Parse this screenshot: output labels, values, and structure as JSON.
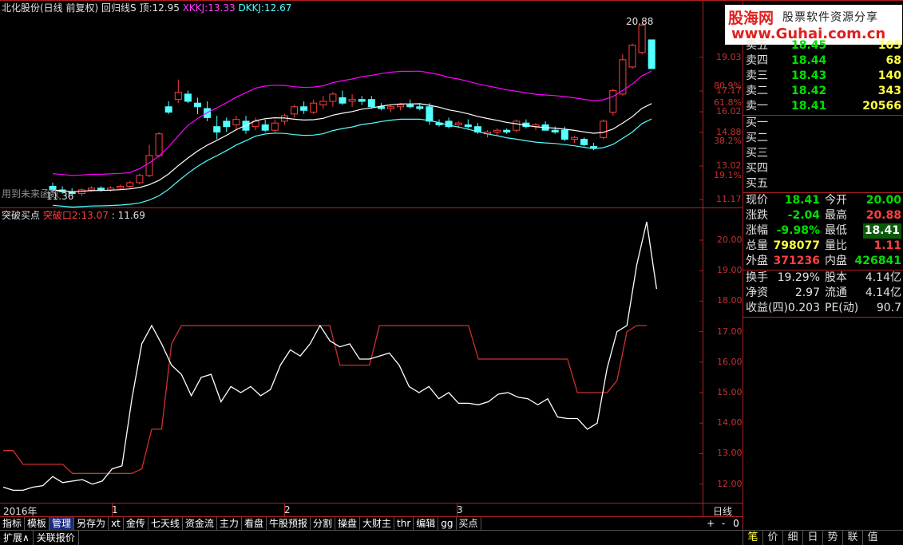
{
  "header": {
    "stock": "北化股份(日线 前复权)",
    "indicator": "回归线S",
    "top_label": "顶:",
    "top_value": "12.95",
    "xkkj_label": "XKKJ:",
    "xkkj_value": "13.33",
    "dkkj_label": "DKKJ:",
    "dkkj_value": "12.67"
  },
  "watermark": {
    "brand": "股海网",
    "slogan": "股票软件资源分享",
    "url": "www.Guhai.com.cn"
  },
  "main_chart": {
    "price_ticks": [
      "19.03",
      "17.17",
      "16.02",
      "14.88",
      "13.02",
      "11.17"
    ],
    "pct_ticks": [
      "80.9%",
      "61.8%",
      "38.2%",
      "19.1%"
    ],
    "high_label": "20.88",
    "low_label": "11.36",
    "note": "用到未来函数"
  },
  "sub_header": {
    "name": "突破买点",
    "line_label": "突破口2:",
    "line_value": "13.07",
    "extra": ": 11.69"
  },
  "sub_ticks": [
    "20.00",
    "19.00",
    "18.00",
    "17.00",
    "16.00",
    "15.00",
    "14.00",
    "13.00",
    "12.00"
  ],
  "x_axis": {
    "year": "2016年",
    "months": [
      "1",
      "2",
      "3"
    ],
    "period": "日线"
  },
  "toolbar_tabs": [
    "指标",
    "模板",
    "管理",
    "另存为",
    "xt",
    "金传",
    "七天线",
    "资金流",
    "主力",
    "看盘",
    "牛股预报",
    "分割",
    "操盘",
    "大财主",
    "thr",
    "编辑",
    "gg",
    "买点"
  ],
  "toolbar_active": "管理",
  "bottom_tabs": [
    "扩展∧",
    "关联报价"
  ],
  "zoom_buttons": [
    "+",
    "-",
    "0"
  ],
  "quote": {
    "sells": [
      {
        "label": "卖五",
        "price": "18.45",
        "vol": "105"
      },
      {
        "label": "卖四",
        "price": "18.44",
        "vol": "68"
      },
      {
        "label": "卖三",
        "price": "18.43",
        "vol": "140"
      },
      {
        "label": "卖二",
        "price": "18.42",
        "vol": "343"
      },
      {
        "label": "卖一",
        "price": "18.41",
        "vol": "20566"
      }
    ],
    "buys": [
      "买一",
      "买二",
      "买三",
      "买四",
      "买五"
    ],
    "stats": [
      {
        "l1": "现价",
        "v1": "18.41",
        "l2": "今开",
        "v2": "20.00"
      },
      {
        "l1": "涨跌",
        "v1": "-2.04",
        "l2": "最高",
        "v2": "20.88"
      },
      {
        "l1": "涨幅",
        "v1": "-9.98%",
        "l2": "最低",
        "v2": "18.41"
      },
      {
        "l1": "总量",
        "v1": "798077",
        "l2": "量比",
        "v2": "1.11"
      },
      {
        "l1": "外盘",
        "v1": "371236",
        "l2": "内盘",
        "v2": "426841"
      }
    ],
    "info": [
      {
        "l1": "换手",
        "v1": "19.29%",
        "l2": "股本",
        "v2": "4.14亿"
      },
      {
        "l1": "净资",
        "v1": "2.97",
        "l2": "流通",
        "v2": "4.14亿"
      },
      {
        "l1": "收益(四)",
        "v1": "0.203",
        "l2": "PE(动)",
        "v2": "90.7"
      }
    ]
  },
  "right_tabs": [
    "笔",
    "价",
    "细",
    "日",
    "势",
    "联",
    "值"
  ],
  "colors": {
    "up": "#ff4040",
    "down": "#54ffff",
    "upper_line": "#ff00ff",
    "mid_line": "#ffffff",
    "lower_line": "#54ffff",
    "sub_red": "#d03030",
    "frame": "#b02020",
    "green": "#00e000",
    "yellow": "#ffff40"
  },
  "chart_data": [
    {
      "type": "candlestick",
      "ylim": [
        11.17,
        20.88
      ],
      "series": [
        {
          "name": "candles",
          "ohlc": [
            [
              11.9,
              12.1,
              11.6,
              11.7
            ],
            [
              11.7,
              11.9,
              11.5,
              11.6
            ],
            [
              11.6,
              11.8,
              11.4,
              11.5
            ],
            [
              11.5,
              11.8,
              11.36,
              11.7
            ],
            [
              11.7,
              11.9,
              11.6,
              11.8
            ],
            [
              11.8,
              11.9,
              11.6,
              11.7
            ],
            [
              11.7,
              11.9,
              11.6,
              11.8
            ],
            [
              11.8,
              12.0,
              11.7,
              11.9
            ],
            [
              11.9,
              12.2,
              11.8,
              12.1
            ],
            [
              12.1,
              12.6,
              12.0,
              12.5
            ],
            [
              12.5,
              14.2,
              12.4,
              13.6
            ],
            [
              13.6,
              14.9,
              13.5,
              14.8
            ],
            [
              16.3,
              16.6,
              15.9,
              16.0
            ],
            [
              16.7,
              17.8,
              16.5,
              17.1
            ],
            [
              17.0,
              17.2,
              16.5,
              16.6
            ],
            [
              16.5,
              16.8,
              15.9,
              16.3
            ],
            [
              16.2,
              16.6,
              15.5,
              15.7
            ],
            [
              15.2,
              15.8,
              14.5,
              14.9
            ],
            [
              15.5,
              15.7,
              14.9,
              15.2
            ],
            [
              15.3,
              15.8,
              15.0,
              15.6
            ],
            [
              15.5,
              15.8,
              14.8,
              15.0
            ],
            [
              15.2,
              15.7,
              15.0,
              15.5
            ],
            [
              15.3,
              15.6,
              14.9,
              15.0
            ],
            [
              15.0,
              15.6,
              14.9,
              15.4
            ],
            [
              15.5,
              15.9,
              15.3,
              15.8
            ],
            [
              15.9,
              16.4,
              15.7,
              16.3
            ],
            [
              16.3,
              16.6,
              15.9,
              16.1
            ],
            [
              16.0,
              16.7,
              15.9,
              16.5
            ],
            [
              16.4,
              16.9,
              16.2,
              16.6
            ],
            [
              16.6,
              17.1,
              16.3,
              17.0
            ],
            [
              16.8,
              17.2,
              16.4,
              16.5
            ],
            [
              16.6,
              17.0,
              16.3,
              16.7
            ],
            [
              16.7,
              16.9,
              16.4,
              16.6
            ],
            [
              16.7,
              16.9,
              16.2,
              16.3
            ],
            [
              16.3,
              16.5,
              16.1,
              16.2
            ],
            [
              16.2,
              16.4,
              16.0,
              16.3
            ],
            [
              16.3,
              16.5,
              16.1,
              16.4
            ],
            [
              16.4,
              16.7,
              16.2,
              16.3
            ],
            [
              16.3,
              16.5,
              16.1,
              16.2
            ],
            [
              16.3,
              16.5,
              15.3,
              15.5
            ],
            [
              15.4,
              15.6,
              15.2,
              15.3
            ],
            [
              15.5,
              15.7,
              15.1,
              15.2
            ],
            [
              15.3,
              15.5,
              15.1,
              15.4
            ],
            [
              15.3,
              15.6,
              15.1,
              15.2
            ],
            [
              15.2,
              15.4,
              14.8,
              14.9
            ],
            [
              14.8,
              15.0,
              14.6,
              14.9
            ],
            [
              14.9,
              15.1,
              14.7,
              15.0
            ],
            [
              15.0,
              15.1,
              14.8,
              14.9
            ],
            [
              15.0,
              15.6,
              14.9,
              15.5
            ],
            [
              15.4,
              15.6,
              15.1,
              15.2
            ],
            [
              15.2,
              15.4,
              15.0,
              15.3
            ],
            [
              15.3,
              15.5,
              15.0,
              15.0
            ],
            [
              15.0,
              15.2,
              14.8,
              14.9
            ],
            [
              15.0,
              15.2,
              14.4,
              14.5
            ],
            [
              14.5,
              14.7,
              14.3,
              14.6
            ],
            [
              14.5,
              14.6,
              14.1,
              14.2
            ],
            [
              14.1,
              14.3,
              13.9,
              14.0
            ],
            [
              14.6,
              15.6,
              14.5,
              15.5
            ],
            [
              16.0,
              17.3,
              15.8,
              17.2
            ],
            [
              17.0,
              19.2,
              16.9,
              18.9
            ],
            [
              18.5,
              19.8,
              18.4,
              19.7
            ],
            [
              19.3,
              20.88,
              19.2,
              20.8
            ],
            [
              20.0,
              20.0,
              18.41,
              18.41
            ]
          ]
        }
      ]
    },
    {
      "type": "line",
      "ylim": [
        11.6,
        20.6
      ],
      "series": [
        {
          "name": "突破买点",
          "values": [
            11.9,
            11.8,
            11.8,
            11.9,
            11.95,
            12.25,
            12.05,
            12.1,
            12.15,
            12.0,
            12.1,
            12.5,
            12.6,
            14.8,
            16.6,
            17.2,
            16.6,
            15.9,
            15.6,
            14.9,
            15.5,
            15.6,
            14.7,
            15.2,
            15.0,
            15.2,
            14.9,
            15.1,
            15.9,
            16.4,
            16.2,
            16.6,
            17.2,
            16.7,
            16.5,
            16.6,
            16.1,
            16.1,
            16.2,
            16.3,
            15.9,
            15.2,
            15.0,
            15.2,
            14.8,
            15.0,
            14.65,
            14.65,
            14.6,
            14.7,
            14.95,
            15.0,
            14.85,
            14.8,
            14.6,
            14.8,
            14.2,
            14.15,
            14.15,
            13.8,
            14.0,
            15.8,
            17.0,
            17.2,
            19.2,
            20.6,
            18.4
          ]
        },
        {
          "name": "突破口2",
          "values": [
            13.1,
            13.1,
            12.65,
            12.65,
            12.65,
            12.65,
            12.65,
            12.35,
            12.35,
            12.35,
            12.35,
            12.35,
            12.35,
            12.35,
            12.5,
            13.8,
            13.8,
            16.6,
            17.2,
            17.2,
            17.2,
            17.2,
            17.2,
            17.2,
            17.2,
            17.2,
            17.2,
            17.2,
            17.2,
            17.2,
            17.2,
            17.2,
            17.2,
            17.2,
            15.9,
            15.9,
            15.9,
            15.9,
            17.2,
            17.2,
            17.2,
            17.2,
            17.2,
            17.2,
            17.2,
            17.2,
            17.2,
            17.2,
            16.1,
            16.1,
            16.1,
            16.1,
            16.1,
            16.1,
            16.1,
            16.1,
            16.1,
            16.1,
            15.0,
            15.0,
            15.0,
            15.0,
            15.4,
            17.0,
            17.2,
            17.2
          ]
        }
      ]
    }
  ]
}
